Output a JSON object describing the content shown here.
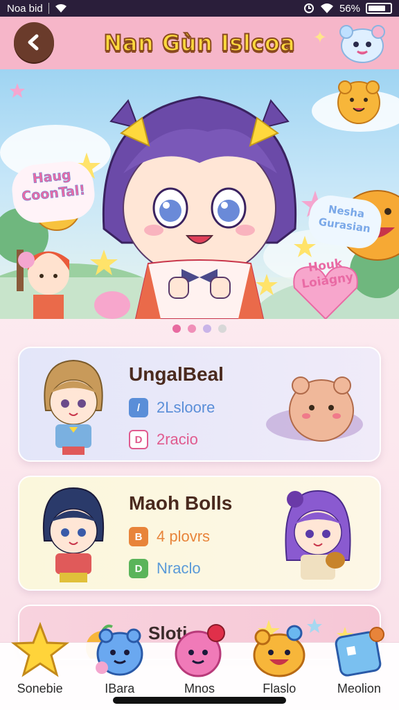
{
  "status_bar": {
    "carrier": "Noa bid",
    "battery": "56%",
    "icons": [
      "wifi-icon",
      "alarm-icon",
      "signal-icon",
      "battery-icon"
    ]
  },
  "header": {
    "title": "Nan Gùn Islcoa",
    "back_icon": "chevron-left-icon",
    "mascot_icon": "blue-mascot-icon",
    "colors": {
      "bar": "#f6b6c9",
      "title": "#ffd93d",
      "back": "#6a3b2b"
    }
  },
  "banner": {
    "badge_left": "Haug CoonTal!",
    "badge_right": "Nesha Gurasian",
    "badge_heart": "Houk Loiagny",
    "pager": {
      "count": 4,
      "active": 0,
      "colors": [
        "#e86aa0",
        "#f08fb8",
        "#c9b4e8",
        "#d8d8d8"
      ]
    }
  },
  "cards": [
    {
      "title": "UngalBeal",
      "line1": {
        "icon": "blue-square-icon",
        "text": "2Lsloore",
        "color": "#5a8ed8",
        "glyph": "/"
      },
      "line2": {
        "icon": "pink-square-icon",
        "text": "2racio",
        "color": "#e05a8e",
        "glyph": "D"
      }
    },
    {
      "title": "Maoh Bolls",
      "line1": {
        "icon": "orange-square-icon",
        "text": "4 plovrs",
        "color": "#e8843a",
        "glyph": "B"
      },
      "line2": {
        "icon": "green-square-icon",
        "text": "Nraclo",
        "color": "#5ab45a",
        "glyph": "D"
      }
    },
    {
      "title": "Sloti"
    }
  ],
  "bottom_nav": [
    {
      "label": "Sonebie",
      "icon": "star-icon"
    },
    {
      "label": "IBara",
      "icon": "blue-blob-icon"
    },
    {
      "label": "Mnos",
      "icon": "pink-blob-icon"
    },
    {
      "label": "Flaslo",
      "icon": "orange-monster-icon"
    },
    {
      "label": "Meolion",
      "icon": "blue-box-icon"
    }
  ]
}
